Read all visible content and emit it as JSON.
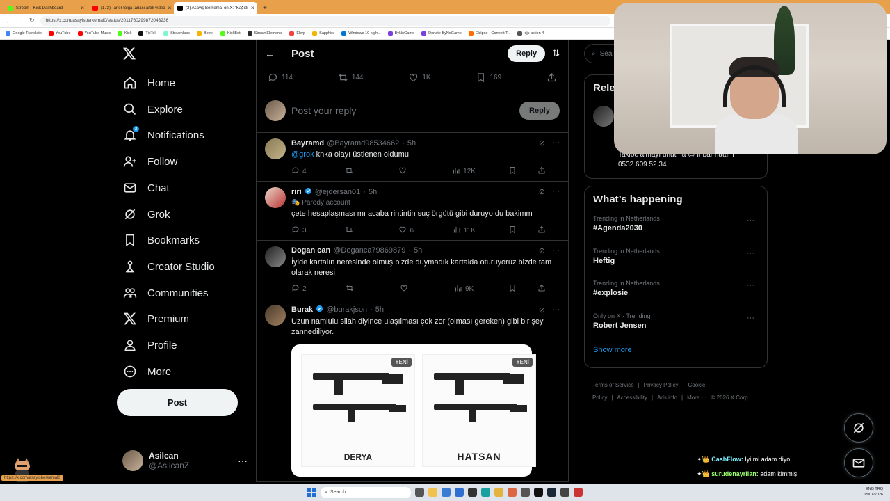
{
  "browser": {
    "tabs": [
      {
        "label": "Stream - Kick Dashboard",
        "color": "#53fc18",
        "active": false
      },
      {
        "label": "(173) Taner tolga tarlacı artık video",
        "color": "#ff0000",
        "active": false
      },
      {
        "label": "(3) Asayiş Berkemal on X: \"Kağıtlı",
        "color": "#000000",
        "active": true
      }
    ],
    "url": "https://x.com/asayisberkemal0/status/2011760299872043236",
    "bookmarks": [
      "Google Translate",
      "YouTube",
      "YouTube Music",
      "Kick",
      "TikTok",
      "Streamlabs",
      "Botrix",
      "KickBot",
      "StreamElements",
      "Elerp",
      "Sapphire",
      "Windows 10 high...",
      "ByNoGame",
      "Donate ByNoGame",
      "Eklipse - Convert T...",
      "djs action 4 -"
    ]
  },
  "sidebar": {
    "items": [
      {
        "label": "Home",
        "icon": "home-icon",
        "badge": ""
      },
      {
        "label": "Explore",
        "icon": "search-icon",
        "badge": ""
      },
      {
        "label": "Notifications",
        "icon": "bell-icon",
        "badge": "3"
      },
      {
        "label": "Follow",
        "icon": "follow-icon",
        "badge": ""
      },
      {
        "label": "Chat",
        "icon": "mail-icon",
        "badge": ""
      },
      {
        "label": "Grok",
        "icon": "grok-icon",
        "badge": ""
      },
      {
        "label": "Bookmarks",
        "icon": "bookmark-icon",
        "badge": ""
      },
      {
        "label": "Creator Studio",
        "icon": "creator-icon",
        "badge": ""
      },
      {
        "label": "Communities",
        "icon": "communities-icon",
        "badge": ""
      },
      {
        "label": "Premium",
        "icon": "x-icon",
        "badge": ""
      },
      {
        "label": "Profile",
        "icon": "profile-icon",
        "badge": ""
      },
      {
        "label": "More",
        "icon": "more-icon",
        "badge": ""
      }
    ],
    "post_label": "Post",
    "account": {
      "name": "Asilcan",
      "handle": "@AsilcanZ"
    }
  },
  "main": {
    "title": "Post",
    "reply_button": "Reply",
    "stats": {
      "replies": "114",
      "reposts": "144",
      "likes": "1K",
      "bookmarks": "169"
    },
    "composer": {
      "placeholder": "Post your reply",
      "button": "Reply"
    },
    "replies": [
      {
        "name": "Bayramd",
        "handle": "@Bayramd98534662",
        "time": "5h",
        "verified": false,
        "parody": "",
        "mention": "@grok",
        "text": " knka olayı üstlenen oldumu",
        "replies": "4",
        "reposts": "",
        "likes": "",
        "views": "12K"
      },
      {
        "name": "riri",
        "handle": "@ejdersan01",
        "time": "5h",
        "verified": true,
        "parody": "Parody account",
        "mention": "",
        "text": "çete hesaplaşması mı acaba rintintin suç örgütü gibi duruyo du bakimm",
        "replies": "3",
        "reposts": "",
        "likes": "6",
        "views": "11K"
      },
      {
        "name": "Dogan can",
        "handle": "@Doganca79869879",
        "time": "5h",
        "verified": false,
        "parody": "",
        "mention": "",
        "text": "İyide kartalın neresinde olmuş bizde duymadık kartalda oturuyoruz bizde tam olarak neresi",
        "replies": "2",
        "reposts": "",
        "likes": "",
        "views": "9K"
      },
      {
        "name": "Burak",
        "handle": "@burakjson",
        "time": "5h",
        "verified": true,
        "parody": "",
        "mention": "",
        "text": "Uzun namlulu silah diyince ulaşılması çok zor (olması gereken) gibi bir şey zannediliyor.",
        "replies": "",
        "reposts": "",
        "likes": "",
        "views": ""
      }
    ],
    "card": {
      "badge": "YENİ",
      "brand_left": "DERYA",
      "brand_right": "HATSAN"
    }
  },
  "right": {
    "search_placeholder": "Sea",
    "relevant_title": "Rele",
    "relevant_bio_line1": "Takibe almayı unutma 😉 İhbar hattım",
    "relevant_bio_line2": "0532 609 52 34",
    "happening_title": "What’s happening",
    "trends": [
      {
        "context": "Trending in Netherlands",
        "name": "#Agenda2030"
      },
      {
        "context": "Trending in Netherlands",
        "name": "Heftig"
      },
      {
        "context": "Trending in Netherlands",
        "name": "#explosie"
      },
      {
        "context": "Only on X · Trending",
        "name": "Robert Jensen"
      }
    ],
    "show_more": "Show more",
    "footer": [
      "Terms of Service",
      "|",
      "Privacy Policy",
      "|",
      "Cookie Policy",
      "|",
      "Accessibility",
      "|",
      "Ads info",
      "|",
      "More ···",
      "© 2026 X Corp."
    ]
  },
  "chat": [
    {
      "user": "CashFlow:",
      "msg": " İyi mi adam diyo",
      "cls": "u1"
    },
    {
      "user": "surudenayrilan:",
      "msg": " adam kimmiş",
      "cls": "u2"
    },
    {
      "user": "CashFlow:",
      "msg": "",
      "cls": "u1"
    }
  ],
  "taskbar": {
    "search": "Search",
    "tray_lang": "ENG TRQ",
    "tray_date": "15/01/2026"
  },
  "status_url": "https://x.com/asayisberkemal0",
  "colors": {
    "accent": "#1d9bf0",
    "bg": "#000000",
    "border": "#2f3336",
    "muted": "#71767b",
    "chrome": "#e8a04a"
  }
}
